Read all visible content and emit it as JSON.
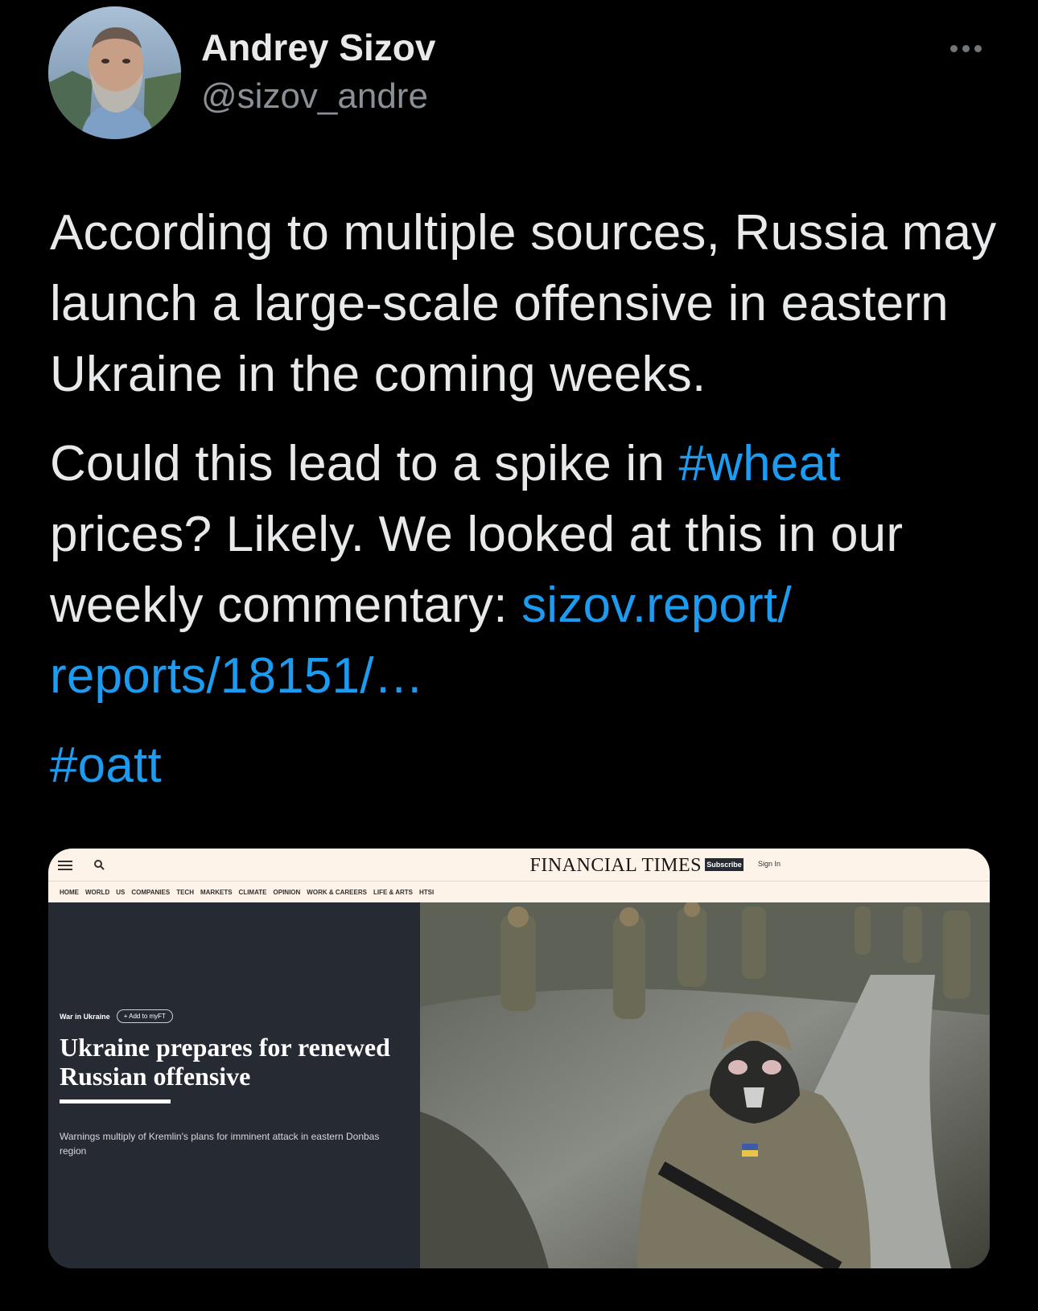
{
  "author": {
    "name": "Andrey Sizov",
    "handle": "@sizov_andre"
  },
  "tweet": {
    "paragraph1": "According to multiple sources, Russia may launch a large-scale offensive in eastern Ukraine in the coming weeks.",
    "paragraph2_text1": "Could this lead to a spike in ",
    "hashtag_wheat": "#wheat",
    "paragraph2_text2": " prices? Likely. We looked at this in our weekly commentary: ",
    "link": "sizov.report/ reports/18151/…",
    "hashtag_oatt": "#oatt"
  },
  "card": {
    "site_logo": "FINANCIAL TIMES",
    "subscribe": "Subscribe",
    "sign_in": "Sign In",
    "nav": [
      "HOME",
      "WORLD",
      "US",
      "COMPANIES",
      "TECH",
      "MARKETS",
      "CLIMATE",
      "OPINION",
      "WORK & CAREERS",
      "LIFE & ARTS",
      "HTSI"
    ],
    "section": "War in Ukraine",
    "add_to_myft": "+ Add to myFT",
    "headline": "Ukraine prepares for renewed Russian offensive",
    "standfirst": "Warnings multiply of Kremlin's plans for imminent attack in eastern Donbas region"
  },
  "colors": {
    "background": "#000000",
    "link": "#1d9bf0",
    "text": "#e7e9ea",
    "secondary_text": "#8b9096",
    "ft_paper": "#fdf3e9",
    "ft_dark": "#262a33"
  },
  "icons": {
    "more": "more-horizontal-icon",
    "ft_menu": "menu-icon",
    "ft_search": "search-icon"
  }
}
